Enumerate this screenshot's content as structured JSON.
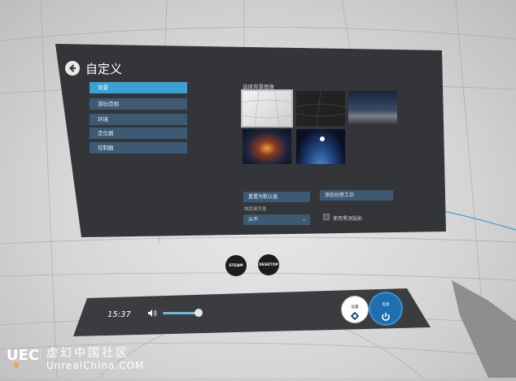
{
  "panel": {
    "title": "自定义",
    "nav": [
      {
        "label": "背景",
        "active": true
      },
      {
        "label": "游玩范围",
        "active": false
      },
      {
        "label": "环境",
        "active": false
      },
      {
        "label": "定位器",
        "active": false
      },
      {
        "label": "控制器",
        "active": false
      }
    ],
    "background_header": "选择背景图像",
    "thumbnails": [
      "white-room",
      "dark-wireframe",
      "night-horizon",
      "city-night",
      "earth-orbit"
    ],
    "selected_thumbnail": "white-room",
    "reset_button": "重置为默认值",
    "add_button": "添加创意工坊",
    "sub_label": "跨距离背景",
    "dropdown_value": "从不",
    "checkbox_label": "使用黑洞投影"
  },
  "floor_buttons": {
    "steam": "STEAM",
    "desktop": "DESKTOP"
  },
  "dock": {
    "time": "15:37",
    "volume": 0.9,
    "settings_label": "设置",
    "power_label": "电源"
  },
  "watermark": {
    "line1": "虚幻中国社区",
    "line2": "UnrealChina.COM"
  },
  "colors": {
    "accent": "#3aa1d4",
    "nav_bg": "#3d5a74",
    "panel_bg": "#333538",
    "power": "#1f6fae"
  }
}
